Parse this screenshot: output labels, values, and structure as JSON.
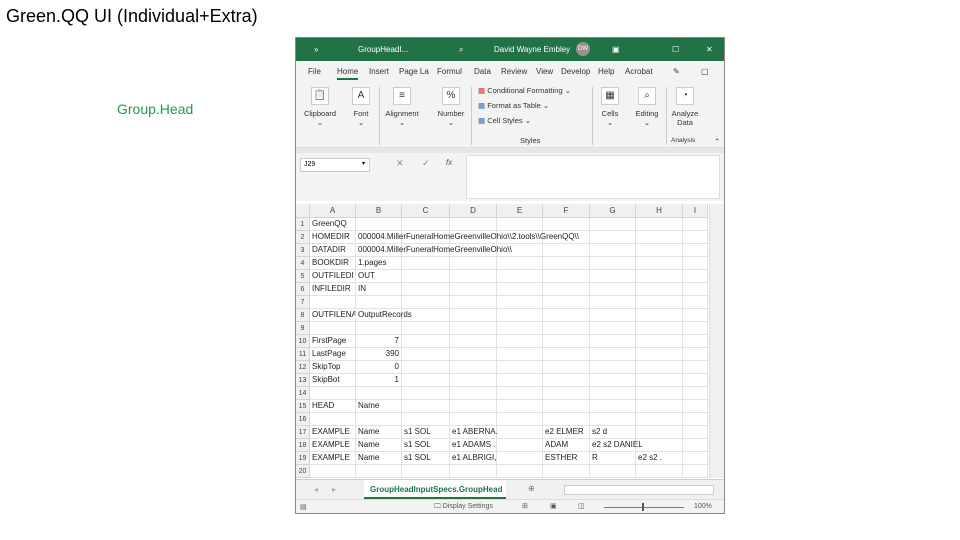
{
  "slide": {
    "title": "Green.QQ UI (Individual+Extra)",
    "subtitle": "Group.Head"
  },
  "titlebar": {
    "file": "GroupHeadI...",
    "user": "David Wayne Embley",
    "initials": "DW"
  },
  "tabs": [
    "File",
    "Home",
    "Insert",
    "Page La",
    "Formul",
    "Data",
    "Review",
    "View",
    "Develop",
    "Help",
    "Acrobat"
  ],
  "ribbon": {
    "clipboard": "Clipboard",
    "font": "Font",
    "alignment": "Alignment",
    "number": "Number",
    "cond": "Conditional Formatting",
    "fmt_table": "Format as Table",
    "cell_styles": "Cell Styles",
    "styles": "Styles",
    "cells": "Cells",
    "editing": "Editing",
    "analyze": "Analyze Data",
    "analysis": "Analysis"
  },
  "formula": {
    "namebox": "J29",
    "value": ""
  },
  "columns": [
    "A",
    "B",
    "C",
    "D",
    "E",
    "F",
    "G",
    "H",
    "I"
  ],
  "rows": [
    [
      "GreenQQ",
      "",
      "",
      "",
      "",
      "",
      "",
      "",
      ""
    ],
    [
      "HOMEDIR",
      "000004.MillerFuneralHomeGreenvilleOhio\\\\2.tools\\\\GreenQQ\\\\",
      "",
      "",
      "",
      "",
      "",
      "",
      ""
    ],
    [
      "DATADIR",
      "000004.MillerFuneralHomeGreenvilleOhio\\\\",
      "",
      "",
      "",
      "",
      "",
      "",
      ""
    ],
    [
      "BOOKDIR",
      "1.pages",
      "",
      "",
      "",
      "",
      "",
      "",
      ""
    ],
    [
      "OUTFILEDI",
      "OUT",
      "",
      "",
      "",
      "",
      "",
      "",
      ""
    ],
    [
      "INFILEDIR",
      "IN",
      "",
      "",
      "",
      "",
      "",
      "",
      ""
    ],
    [
      "",
      "",
      "",
      "",
      "",
      "",
      "",
      "",
      ""
    ],
    [
      "OUTFILENA",
      "OutputRecords",
      "",
      "",
      "",
      "",
      "",
      "",
      ""
    ],
    [
      "",
      "",
      "",
      "",
      "",
      "",
      "",
      "",
      ""
    ],
    [
      "FirstPage",
      "7",
      "",
      "",
      "",
      "",
      "",
      "",
      ""
    ],
    [
      "LastPage",
      "390",
      "",
      "",
      "",
      "",
      "",
      "",
      ""
    ],
    [
      "SkipTop",
      "0",
      "",
      "",
      "",
      "",
      "",
      "",
      ""
    ],
    [
      "SkipBot",
      "1",
      "",
      "",
      "",
      "",
      "",
      "",
      ""
    ],
    [
      "",
      "",
      "",
      "",
      "",
      "",
      "",
      "",
      ""
    ],
    [
      "HEAD",
      "Name",
      "",
      "",
      "",
      "",
      "",
      "",
      ""
    ],
    [
      "",
      "",
      "",
      "",
      "",
      "",
      "",
      "",
      ""
    ],
    [
      "EXAMPLE",
      "Name",
      "s1 SOL",
      "e1 ABERNA.",
      "",
      "e2 ELMER",
      "s2 d",
      "",
      ""
    ],
    [
      "EXAMPLE",
      "Name",
      "s1 SOL",
      "e1 ADAMS .",
      "",
      "ADAM",
      "e2 s2 DANIEL",
      "",
      ""
    ],
    [
      "EXAMPLE",
      "Name",
      "s1 SOL",
      "e1 ALBRIGI,",
      "",
      "ESTHER",
      "R",
      "e2 s2 .",
      ""
    ],
    [
      "",
      "",
      "",
      "",
      "",
      "",
      "",
      "",
      ""
    ]
  ],
  "sheet_tab": "GroupHeadInputSpecs.GroupHead",
  "status": {
    "display": "Display Settings",
    "zoom": "100%"
  }
}
